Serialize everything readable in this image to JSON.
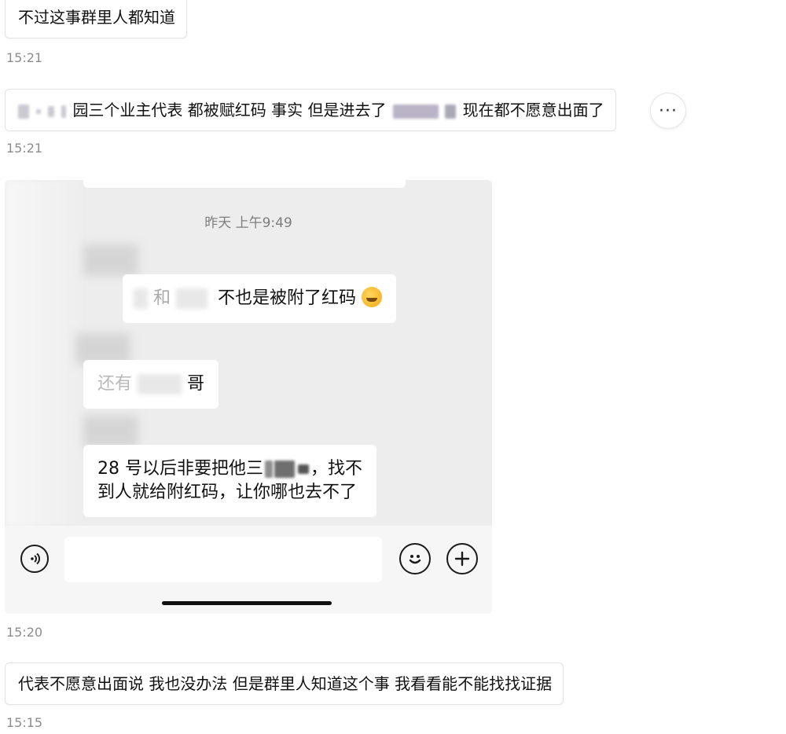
{
  "messages": [
    {
      "text": "不过这事群里人都知道",
      "time": "15:21"
    },
    {
      "text_a": "园三个业主代表 都被赋红码 事实 但是进去了",
      "text_b": "现在都不愿意出面了",
      "time": "15:21"
    },
    {
      "time": "15:20"
    },
    {
      "text": "代表不愿意出面说 我也没办法 但是群里人知道这个事 我看看能不能找找证据",
      "time": "15:15"
    }
  ],
  "more_button": {
    "label": "···"
  },
  "screenshot": {
    "timestamp": "昨天 上午9:49",
    "bubble1_a": "和",
    "bubble1_b": "不也是被附了红码",
    "bubble2_a": "还有",
    "bubble2_b": "哥",
    "bubble3_line1_a": "28 号以后非要把他三",
    "bubble3_line1_b": "，找不",
    "bubble3_line2": "到人就给附红码，让你哪也去不了"
  },
  "icons": [
    "voice-icon",
    "emoji-icon",
    "plus-icon",
    "more-icon",
    "laughing-tears-emoji-icon"
  ]
}
